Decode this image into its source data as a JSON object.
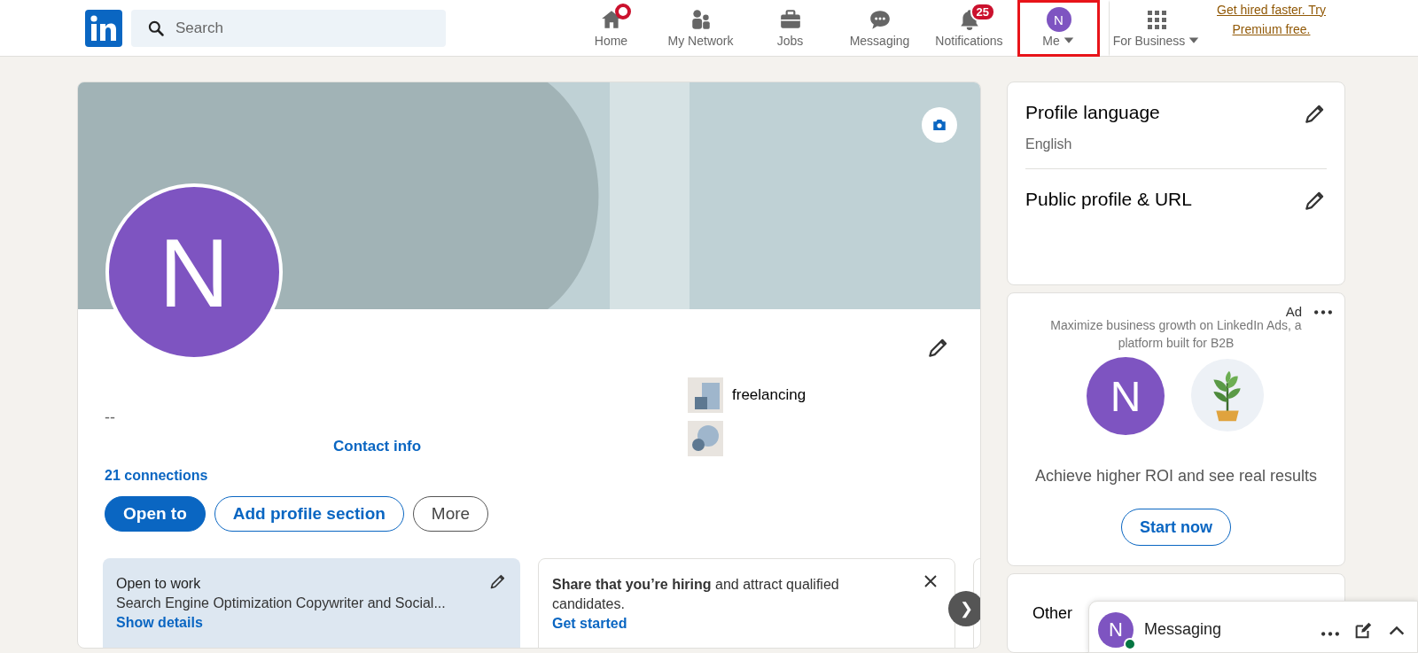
{
  "header": {
    "search": {
      "placeholder": "Search"
    },
    "nav": [
      {
        "kind": "home",
        "label": "Home",
        "dot": true,
        "highlighted": false
      },
      {
        "kind": "network",
        "label": "My Network",
        "highlighted": false
      },
      {
        "kind": "jobs",
        "label": "Jobs",
        "highlighted": false
      },
      {
        "kind": "messaging",
        "label": "Messaging",
        "highlighted": false
      },
      {
        "kind": "notifications",
        "label": "Notifications",
        "badge": "25",
        "highlighted": false
      },
      {
        "kind": "me",
        "label": "Me",
        "avatar": "N",
        "highlighted": true
      },
      {
        "kind": "business",
        "label": "For Business",
        "highlighted": false
      }
    ],
    "premium_link": "Get hired faster. Try Premium free."
  },
  "profile": {
    "avatar": "N",
    "headline": "--",
    "contact_link": "Contact info",
    "connections": "21 connections",
    "buttons": [
      {
        "kind": "primary",
        "label": "Open to"
      },
      {
        "kind": "outline",
        "label": "Add profile section"
      },
      {
        "kind": "neutral",
        "label": "More"
      }
    ],
    "highlights": [
      {
        "kind": "company",
        "label": "freelancing"
      },
      {
        "kind": "school"
      }
    ],
    "cards": [
      {
        "kind": "open-to-work",
        "title": "Open to work",
        "text": "Search Engine Optimization Copywriter and Social...",
        "link": "Show details"
      },
      {
        "kind": "hiring",
        "text": "**Share that you’re hiring** and attract qualified candidates.",
        "link": "Get started"
      }
    ],
    "next_button": "❯"
  },
  "sidebar": {
    "profile_language": {
      "title": "Profile language",
      "value": "English"
    },
    "public_profile": {
      "title": "Public profile & URL"
    },
    "ad": {
      "label": "Ad",
      "tagline": "Maximize business growth on LinkedIn Ads, a platform built for B2B",
      "avatar": "N",
      "headline": "Achieve higher ROI and see real results",
      "button": "Start now"
    },
    "other": {
      "title": "Other"
    }
  },
  "messaging": {
    "avatar": "N",
    "online": true,
    "title": "Messaging"
  }
}
